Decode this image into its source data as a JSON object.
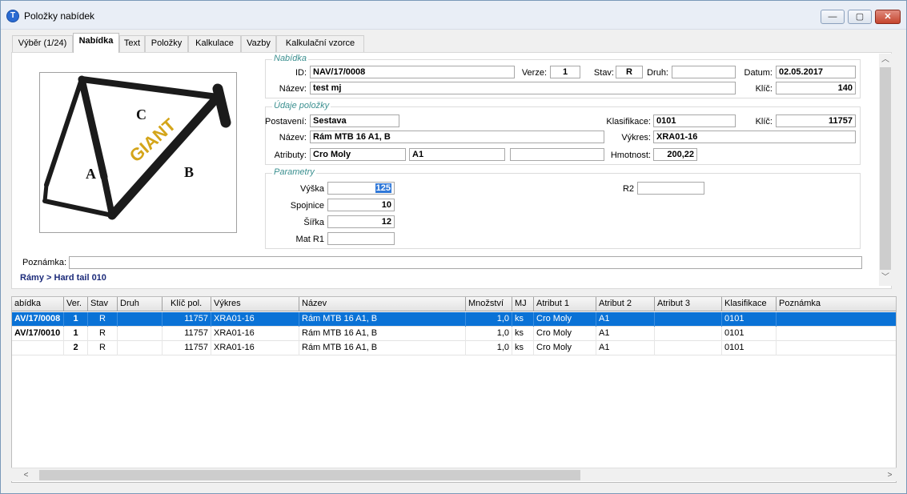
{
  "window": {
    "title": "Položky nabídek",
    "minimize": "—",
    "maximize": "▢",
    "close": "✕"
  },
  "tabs": [
    "Výběr (1/24)",
    "Nabídka",
    "Text",
    "Položky",
    "Kalkulace",
    "Vazby",
    "Kalkulační vzorce"
  ],
  "image": {
    "labels": {
      "c": "C",
      "a": "A",
      "b": "B",
      "brand": "GIANT"
    }
  },
  "nabidka": {
    "legend": "Nabídka",
    "id_label": "ID:",
    "id_value": "NAV/17/0008",
    "verze_label": "Verze:",
    "verze_value": "1",
    "stav_label": "Stav:",
    "stav_value": "R",
    "druh_label": "Druh:",
    "druh_value": "",
    "datum_label": "Datum:",
    "datum_value": "02.05.2017",
    "nazev_label": "Název:",
    "nazev_value": "test mj",
    "klic_label": "Klíč:",
    "klic_value": "140"
  },
  "udaje": {
    "legend": "Údaje položky",
    "postaveni_label": "Postavení:",
    "postaveni_value": "Sestava",
    "klasifikace_label": "Klasifikace:",
    "klasifikace_value": "0101",
    "klic_label": "Klíč:",
    "klic_value": "11757",
    "nazev_label": "Název:",
    "nazev_value": "Rám MTB 16 A1, B",
    "vykres_label": "Výkres:",
    "vykres_value": "XRA01-16",
    "atributy_label": "Atributy:",
    "atribut1": "Cro Moly",
    "atribut2": "A1",
    "atribut3": "",
    "hmotnost_label": "Hmotnost:",
    "hmotnost_value": "200,22"
  },
  "parametry": {
    "legend": "Parametry",
    "vyska_label": "Výška",
    "vyska_value": "125",
    "spojnice_label": "Spojnice",
    "spojnice_value": "10",
    "sirka_label": "Šířka",
    "sirka_value": "12",
    "matr1_label": "Mat R1",
    "matr1_value": "",
    "r2_label": "R2",
    "r2_value": ""
  },
  "poznamka": {
    "label": "Poznámka:",
    "value": ""
  },
  "breadcrumb": "Rámy > Hard tail 010",
  "grid": {
    "columns": [
      "abídka",
      "Ver.",
      "Stav",
      "Druh",
      "Klíč pol.",
      "Výkres",
      "Název",
      "Množství",
      "MJ",
      "Atribut 1",
      "Atribut 2",
      "Atribut 3",
      "Klasifikace",
      "Poznámka"
    ],
    "rows": [
      [
        "AV/17/0008",
        "1",
        "R",
        "",
        "11757",
        "XRA01-16",
        "Rám MTB 16 A1, B",
        "1,0",
        "ks",
        "Cro Moly",
        "A1",
        "",
        "0101",
        ""
      ],
      [
        "AV/17/0010",
        "1",
        "R",
        "",
        "11757",
        "XRA01-16",
        "Rám MTB 16 A1, B",
        "1,0",
        "ks",
        "Cro Moly",
        "A1",
        "",
        "0101",
        ""
      ],
      [
        "",
        "2",
        "R",
        "",
        "11757",
        "XRA01-16",
        "Rám MTB 16 A1, B",
        "1,0",
        "ks",
        "Cro Moly",
        "A1",
        "",
        "0101",
        ""
      ]
    ]
  },
  "colors": {
    "selection": "#0a72d6",
    "legend": "#3a8f8f",
    "breadcrumb": "#1c2b7a"
  }
}
